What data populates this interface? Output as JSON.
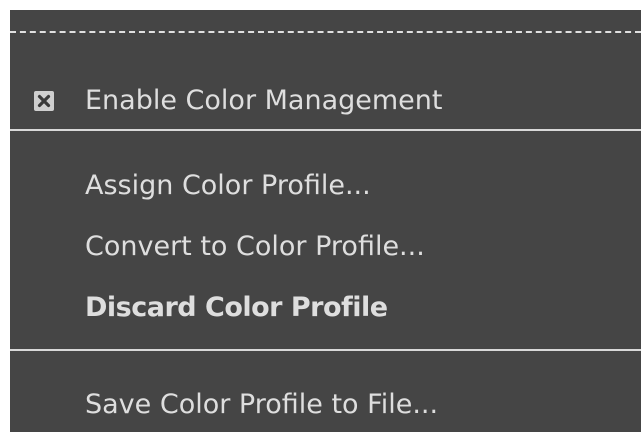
{
  "menu": {
    "items": [
      {
        "label": "Enable Color Management",
        "checked": true,
        "icon": "checkbox-checked-icon"
      },
      {
        "label": "Assign Color Profile..."
      },
      {
        "label": "Convert to Color Profile..."
      },
      {
        "label": "Discard Color Profile"
      },
      {
        "label": "Save Color Profile to File..."
      }
    ]
  },
  "colors": {
    "menu_background": "#454545",
    "text": "#dedede",
    "separator": "#d8d8d8"
  }
}
